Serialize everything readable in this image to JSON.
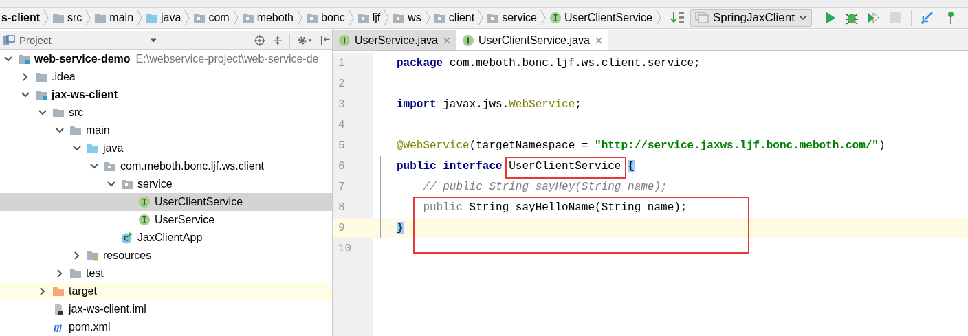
{
  "breadcrumb": [
    {
      "label": "s-client",
      "kind": "module"
    },
    {
      "label": "src",
      "kind": "folder"
    },
    {
      "label": "main",
      "kind": "folder"
    },
    {
      "label": "java",
      "kind": "source"
    },
    {
      "label": "com",
      "kind": "package"
    },
    {
      "label": "meboth",
      "kind": "package"
    },
    {
      "label": "bonc",
      "kind": "package"
    },
    {
      "label": "ljf",
      "kind": "package"
    },
    {
      "label": "ws",
      "kind": "package"
    },
    {
      "label": "client",
      "kind": "package"
    },
    {
      "label": "service",
      "kind": "package"
    },
    {
      "label": "UserClientService",
      "kind": "interface"
    }
  ],
  "run_config": {
    "label": "SpringJaxClient"
  },
  "toolbar": [
    {
      "kind": "run",
      "disabled": false
    },
    {
      "kind": "debug",
      "disabled": false
    },
    {
      "kind": "coverage",
      "disabled": false
    },
    {
      "kind": "stop",
      "disabled": true
    },
    {
      "kind": "vcs-update",
      "disabled": false
    },
    {
      "kind": "vcs-commit",
      "disabled": false
    }
  ],
  "project_panel": {
    "title": "Project"
  },
  "tree": [
    {
      "label": "web-service-demo",
      "detail": "E:\\webservice-project\\web-service-de",
      "kind": "module",
      "expanded": true,
      "selected": false,
      "highlighted": false,
      "children": [
        {
          "label": ".idea",
          "kind": "folder",
          "expanded": false,
          "selected": false,
          "highlighted": false
        },
        {
          "label": "jax-ws-client",
          "kind": "module",
          "expanded": true,
          "selected": false,
          "highlighted": false,
          "children": [
            {
              "label": "src",
              "kind": "folder",
              "expanded": true,
              "selected": false,
              "highlighted": false,
              "children": [
                {
                  "label": "main",
                  "kind": "folder",
                  "expanded": true,
                  "selected": false,
                  "highlighted": false,
                  "children": [
                    {
                      "label": "java",
                      "kind": "source",
                      "expanded": true,
                      "selected": false,
                      "highlighted": false,
                      "children": [
                        {
                          "label": "com.meboth.bonc.ljf.ws.client",
                          "kind": "package",
                          "expanded": true,
                          "selected": false,
                          "highlighted": false,
                          "children": [
                            {
                              "label": "service",
                              "kind": "package",
                              "expanded": true,
                              "selected": false,
                              "highlighted": false,
                              "children": [
                                {
                                  "label": "UserClientService",
                                  "kind": "interface",
                                  "selected": true,
                                  "highlighted": false
                                },
                                {
                                  "label": "UserService",
                                  "kind": "interface",
                                  "selected": false,
                                  "highlighted": false
                                }
                              ]
                            },
                            {
                              "label": "JaxClientApp",
                              "kind": "class",
                              "selected": false,
                              "highlighted": false
                            }
                          ]
                        }
                      ]
                    },
                    {
                      "label": "resources",
                      "kind": "resources",
                      "expanded": false,
                      "selected": false,
                      "highlighted": false
                    }
                  ]
                },
                {
                  "label": "test",
                  "kind": "folder",
                  "expanded": false,
                  "selected": false,
                  "highlighted": false
                }
              ]
            },
            {
              "label": "target",
              "kind": "excluded",
              "expanded": false,
              "selected": false,
              "highlighted": true
            },
            {
              "label": "jax-ws-client.iml",
              "kind": "iml",
              "selected": false,
              "highlighted": false
            },
            {
              "label": "pom.xml",
              "kind": "maven",
              "selected": false,
              "highlighted": false
            }
          ]
        }
      ]
    }
  ],
  "editor_tabs": [
    {
      "label": "UserService.java",
      "selected": false
    },
    {
      "label": "UserClientService.java",
      "selected": true
    }
  ],
  "code": [
    {
      "number": "1",
      "current": false,
      "indented": false,
      "tokens": [
        {
          "kind": "keyword",
          "text": "package"
        },
        {
          "kind": "plain",
          "text": " com.meboth.bonc.ljf.ws.client.service;"
        }
      ]
    },
    {
      "number": "2",
      "current": false
    },
    {
      "number": "3",
      "current": false,
      "indented": false,
      "tokens": [
        {
          "kind": "keyword",
          "text": "import"
        },
        {
          "kind": "plain",
          "text": " javax.jws."
        },
        {
          "kind": "unused-import",
          "text": "WebService"
        },
        {
          "kind": "plain",
          "text": ";"
        }
      ]
    },
    {
      "number": "4",
      "current": false
    },
    {
      "number": "5",
      "current": false,
      "indented": false,
      "tokens": [
        {
          "kind": "annotation",
          "text": "@WebService"
        },
        {
          "kind": "plain",
          "text": "(targetNamespace = "
        },
        {
          "kind": "string",
          "text": "\"http://service.jaxws.ljf.bonc.meboth.com/\""
        },
        {
          "kind": "plain",
          "text": ")"
        }
      ]
    },
    {
      "number": "6",
      "current": false,
      "indented": false,
      "tokens": [
        {
          "kind": "keyword",
          "text": "public interface"
        },
        {
          "kind": "plain",
          "text": " UserClientService "
        },
        {
          "kind": "brace-match",
          "text": "{"
        }
      ]
    },
    {
      "number": "7",
      "current": false,
      "indented": true,
      "tokens": [
        {
          "kind": "comment",
          "text": "// public String sayHey(String name);"
        }
      ]
    },
    {
      "number": "8",
      "current": false,
      "indented": true,
      "tokens": [
        {
          "kind": "unused",
          "text": "public"
        },
        {
          "kind": "plain",
          "text": " String sayHelloName(String name);"
        }
      ]
    },
    {
      "number": "9",
      "current": true,
      "indented": false,
      "tokens": [
        {
          "kind": "brace-match",
          "text": "}"
        }
      ]
    },
    {
      "number": "10",
      "current": false
    }
  ]
}
